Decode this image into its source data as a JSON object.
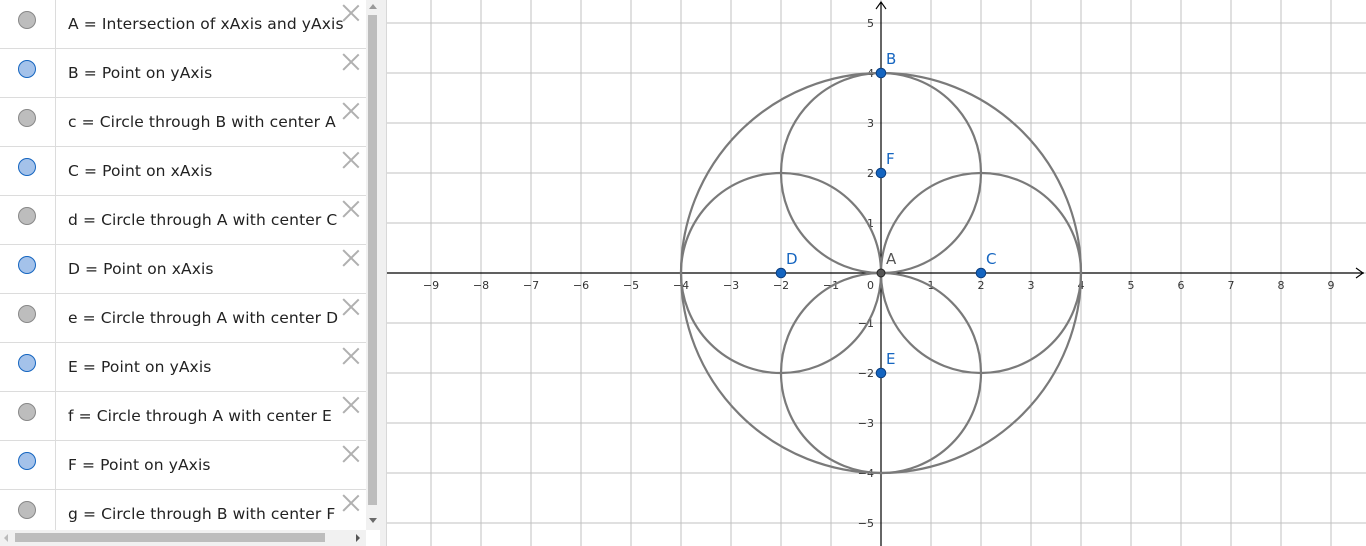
{
  "algebra_view": {
    "items": [
      {
        "description": "A = Intersection of xAxis and yAxis",
        "visible": false
      },
      {
        "description": "B = Point on yAxis",
        "visible": true
      },
      {
        "description": "c = Circle through B with center A",
        "visible": false
      },
      {
        "description": "C = Point on xAxis",
        "visible": true
      },
      {
        "description": "d = Circle through A with center C",
        "visible": false
      },
      {
        "description": "D = Point on xAxis",
        "visible": true
      },
      {
        "description": "e = Circle through A with center D",
        "visible": false
      },
      {
        "description": "E = Point on yAxis",
        "visible": true
      },
      {
        "description": "f = Circle through A with center E",
        "visible": false
      },
      {
        "description": "F = Point on yAxis",
        "visible": true
      },
      {
        "description": "g = Circle through B with center F",
        "visible": false
      }
    ]
  },
  "graphics_view": {
    "x_ticks": [
      "−9",
      "−8",
      "−7",
      "−6",
      "−5",
      "−4",
      "−3",
      "−2",
      "−1",
      "1",
      "2",
      "3",
      "4",
      "5",
      "6",
      "7",
      "8",
      "9"
    ],
    "x_tick_values": [
      -9,
      -8,
      -7,
      -6,
      -5,
      -4,
      -3,
      -2,
      -1,
      1,
      2,
      3,
      4,
      5,
      6,
      7,
      8,
      9
    ],
    "y_ticks": [
      "5",
      "4",
      "3",
      "2",
      "1",
      "−1",
      "−2",
      "−3",
      "−4",
      "−5"
    ],
    "y_tick_values": [
      5,
      4,
      3,
      2,
      1,
      -1,
      -2,
      -3,
      -4,
      -5
    ],
    "origin_label": "0",
    "colors": {
      "point": "#1565c0",
      "point_free_dark": "#555555",
      "circle": "#7a7a7a",
      "grid": "#c0c0c0",
      "axis": "#000000"
    },
    "points": [
      {
        "name": "A",
        "x": 0,
        "y": 0,
        "style": "dark"
      },
      {
        "name": "B",
        "x": 0,
        "y": 4,
        "style": "blue"
      },
      {
        "name": "C",
        "x": 2,
        "y": 0,
        "style": "blue"
      },
      {
        "name": "D",
        "x": -2,
        "y": 0,
        "style": "blue"
      },
      {
        "name": "E",
        "x": 0,
        "y": -2,
        "style": "blue"
      },
      {
        "name": "F",
        "x": 0,
        "y": 2,
        "style": "blue"
      }
    ],
    "circles": [
      {
        "name": "c",
        "cx": 0,
        "cy": 0,
        "r": 4
      },
      {
        "name": "d",
        "cx": 2,
        "cy": 0,
        "r": 2
      },
      {
        "name": "e",
        "cx": -2,
        "cy": 0,
        "r": 2
      },
      {
        "name": "f",
        "cx": 0,
        "cy": -2,
        "r": 2
      },
      {
        "name": "g",
        "cx": 0,
        "cy": 2,
        "r": 2
      }
    ]
  }
}
